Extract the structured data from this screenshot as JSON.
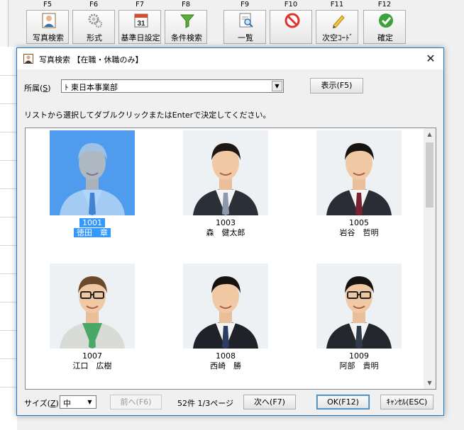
{
  "toolbar": {
    "buttons": [
      {
        "key": "F5",
        "label": "写真検索",
        "icon": "person-photo-icon"
      },
      {
        "key": "F6",
        "label": "形式",
        "icon": "gears-icon"
      },
      {
        "key": "F7",
        "label": "基準日設定",
        "icon": "calendar-icon",
        "icon_text": "31"
      },
      {
        "key": "F8",
        "label": "条件検索",
        "icon": "funnel-icon"
      },
      {
        "key": "F9",
        "label": "一覧",
        "icon": "list-magnifier-icon"
      },
      {
        "key": "F10",
        "label": "",
        "icon": "no-entry-icon"
      },
      {
        "key": "F11",
        "label": "次空ｺｰﾄﾞ",
        "icon": "pencil-icon"
      },
      {
        "key": "F12",
        "label": "確定",
        "icon": "check-circle-icon"
      }
    ]
  },
  "dialog": {
    "title": "写真検索 【在職・休職のみ】",
    "affiliation_label": "所属(",
    "affiliation_key": "S",
    "affiliation_close": ")",
    "affiliation_value": "ﾄ 東日本事業部",
    "show_button": "表示(F5)",
    "hint": "リストから選択してダブルクリックまたはEnterで決定してください。",
    "employees": [
      {
        "code": "1001",
        "name": "徳田　章",
        "selected": true,
        "hair": "#d7d7d7",
        "shirt": "#f4f6f8",
        "tie": "#4a78b8",
        "suit": "#dfe6ee",
        "glasses": false
      },
      {
        "code": "1003",
        "name": "森　健太郎",
        "selected": false,
        "hair": "#1c1712",
        "shirt": "#f4f4f4",
        "tie": "#8c99ad",
        "suit": "#2b2f38",
        "glasses": false
      },
      {
        "code": "1005",
        "name": "岩谷　哲明",
        "selected": false,
        "hair": "#17130f",
        "shirt": "#f4f4f4",
        "tie": "#7b2230",
        "suit": "#2a2d35",
        "glasses": false
      },
      {
        "code": "1007",
        "name": "江口　広樹",
        "selected": false,
        "hair": "#6b4a2c",
        "shirt": "#4aa866",
        "tie": "#4aa866",
        "suit": "#d9dcd6",
        "glasses": true
      },
      {
        "code": "1008",
        "name": "西崎　勝",
        "selected": false,
        "hair": "#15120f",
        "shirt": "#f4f4f4",
        "tie": "#2e3d63",
        "suit": "#1f2229",
        "glasses": false
      },
      {
        "code": "1009",
        "name": "阿部　貴明",
        "selected": false,
        "hair": "#15120f",
        "shirt": "#f4f4f4",
        "tie": "#2f3a4a",
        "suit": "#23262d",
        "glasses": true
      }
    ],
    "size_label": "サイズ(",
    "size_key": "Z",
    "size_close": ")",
    "size_value": "中",
    "prev_button": "前へ(F6)",
    "count_text": "52件 1/3ページ",
    "next_button": "次へ(F7)",
    "ok_button": "OK(F12)",
    "cancel_button": "ｷｬﾝｾﾙ(ESC)"
  },
  "colors": {
    "selection": "#3399ff",
    "accent_border": "#1979ca"
  }
}
